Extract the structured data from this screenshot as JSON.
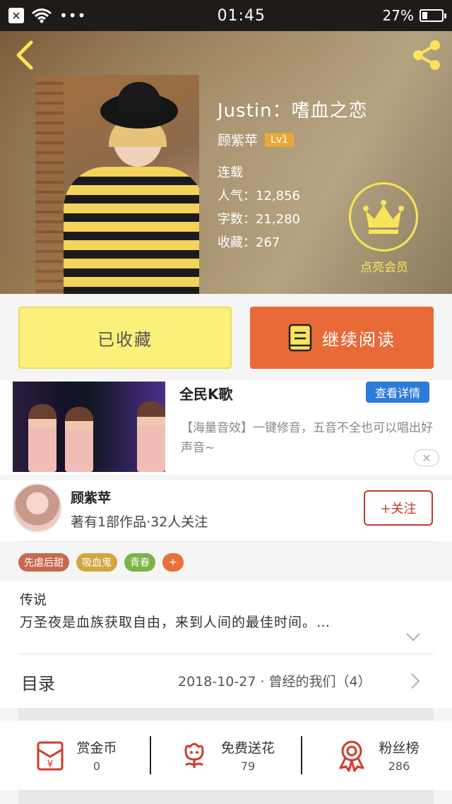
{
  "status_bar": {
    "time": "01:45",
    "battery": "27%",
    "battery_level": 0.27,
    "dots": "•••"
  },
  "book": {
    "title": "Justin：嗜血之恋",
    "author": "顾紫苹",
    "level": "Lv1",
    "status": "连载",
    "popularity": "人气：12,856",
    "word_count": "字数：21,280",
    "favorites": "收藏：267"
  },
  "vip": {
    "label": "点亮会员"
  },
  "actions": {
    "collected_label": "已收藏",
    "continue_label": "继续阅读"
  },
  "ad": {
    "title": "全民K歌",
    "detail_label": "查看详情",
    "description": "【海量音效】一键修音，五音不全也可以唱出好声音~",
    "close_symbol": "✕"
  },
  "author_card": {
    "name": "顾紫苹",
    "summary": "著有1部作品·32人关注",
    "follow_label": "+关注"
  },
  "tags": [
    {
      "label": "先虐后甜",
      "color": "#c8694e"
    },
    {
      "label": "吸血鬼",
      "color": "#d4a53c"
    },
    {
      "label": "青春",
      "color": "#7ab447"
    },
    {
      "label": "+",
      "color": "#e8703a"
    }
  ],
  "intro": {
    "heading": "传说",
    "text": "万圣夜是血族获取自由，来到人间的最佳时间。…"
  },
  "toc": {
    "title": "目录",
    "latest": "2018-10-27 · 曾经的我们（4）"
  },
  "bottom": [
    {
      "label": "赏金币",
      "count": "0",
      "icon": "red-envelope-icon"
    },
    {
      "label": "免费送花",
      "count": "79",
      "icon": "flower-icon"
    },
    {
      "label": "粉丝榜",
      "count": "286",
      "icon": "medal-icon"
    }
  ],
  "colors": {
    "accent_orange": "#e96a37",
    "collected_yellow": "#fbf07a",
    "crown_yellow": "#f8e45a",
    "follow_red": "#c33a2a",
    "ad_blue": "#2d7bd9"
  }
}
